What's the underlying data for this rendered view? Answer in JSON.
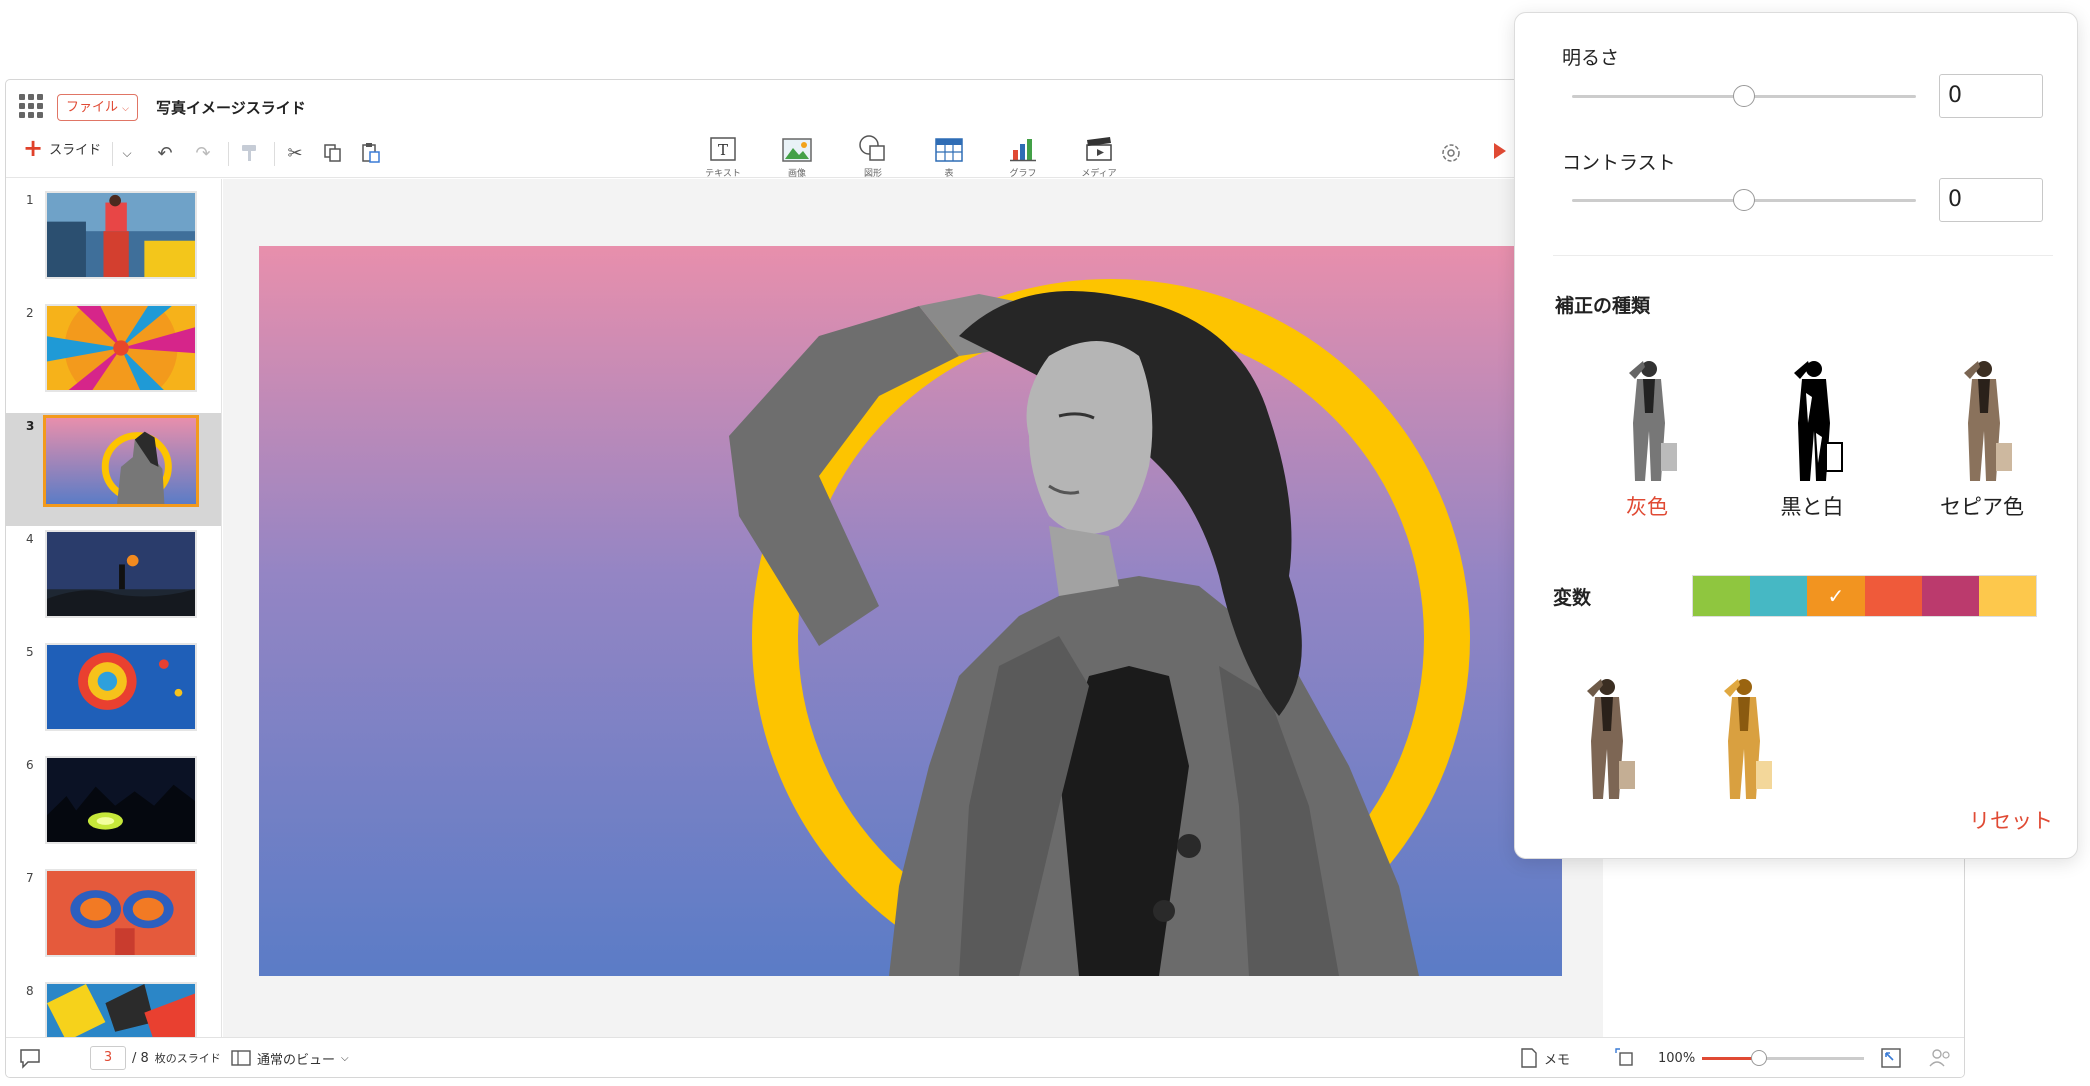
{
  "titlebar": {
    "file_menu": "ファイル",
    "document_title": "写真イメージスライド"
  },
  "toolbar": {
    "add_slide_label": "スライド",
    "insert_items": [
      {
        "label": "テキスト",
        "icon": "text-box-icon"
      },
      {
        "label": "画像",
        "icon": "image-icon"
      },
      {
        "label": "図形",
        "icon": "shape-icon"
      },
      {
        "label": "表",
        "icon": "table-icon"
      },
      {
        "label": "グラフ",
        "icon": "chart-icon"
      },
      {
        "label": "メディア",
        "icon": "media-icon"
      }
    ]
  },
  "slides": {
    "items": [
      {
        "number": "1"
      },
      {
        "number": "2"
      },
      {
        "number": "3"
      },
      {
        "number": "4"
      },
      {
        "number": "5"
      },
      {
        "number": "6"
      },
      {
        "number": "7"
      },
      {
        "number": "8"
      }
    ],
    "active_index": 3
  },
  "statusbar": {
    "current_page": "3",
    "total_pages": "/ 8",
    "pages_suffix": "枚のスライド",
    "view_mode": "通常のビュー",
    "notes_label": "メモ",
    "zoom": "100%",
    "zoom_level_fraction": 0.35
  },
  "picture_panel": {
    "brightness_label": "明るさ",
    "brightness_value": "0",
    "brightness_fraction": 0.5,
    "contrast_label": "コントラスト",
    "contrast_value": "0",
    "contrast_fraction": 0.5,
    "correction_heading": "補正の種類",
    "correction_types": [
      {
        "label": "灰色",
        "selected": true
      },
      {
        "label": "黒と白",
        "selected": false
      },
      {
        "label": "セピア色",
        "selected": false
      }
    ],
    "variants_label": "変数",
    "variant_colors": [
      "#8fc63f",
      "#46b8c4",
      "#f29420",
      "#ef5a3a",
      "#bb3a6d",
      "#fdc84c"
    ],
    "selected_variant_index": 2,
    "reset_label": "リセット"
  },
  "colors": {
    "accent": "#e04a34",
    "thumb_selected_border": "#f39a1c",
    "slide_gradient_top": "#e88fac",
    "slide_gradient_bottom": "#5b7cc6",
    "ring": "#fdc400"
  }
}
